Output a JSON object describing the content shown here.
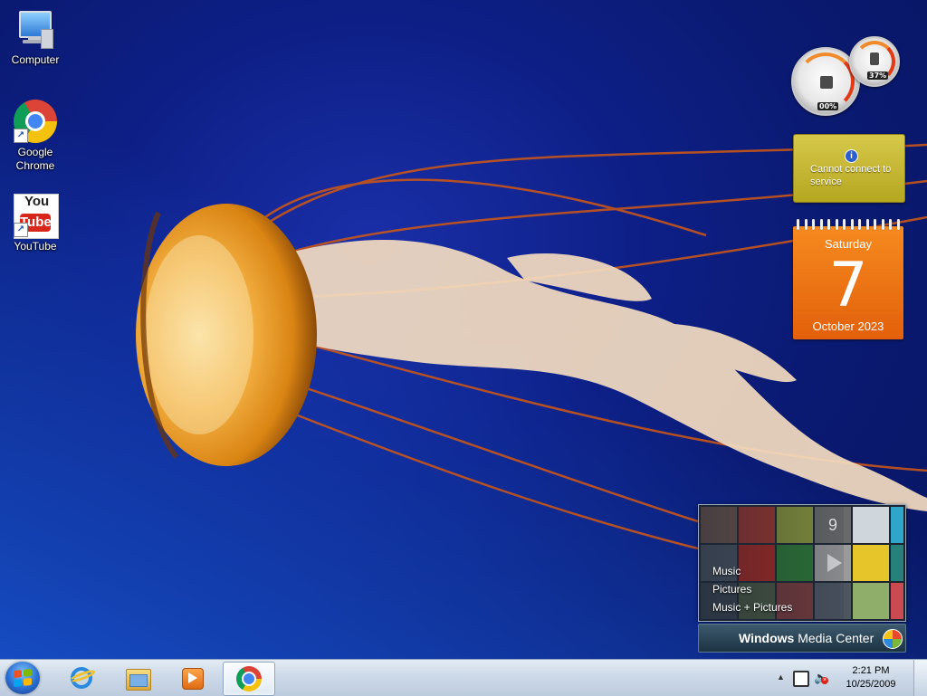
{
  "desktop": {
    "icons": [
      {
        "label": "Computer",
        "icon": "computer-icon"
      },
      {
        "label": "Google Chrome",
        "icon": "chrome-icon"
      },
      {
        "label": "YouTube",
        "icon": "youtube-icon"
      }
    ],
    "youtube_logo_text": {
      "you": "You",
      "tube": "Tube"
    }
  },
  "gadgets": {
    "cpu_meter": {
      "cpu_percent": "00%",
      "memory_percent": "37%"
    },
    "weather": {
      "message": "Cannot connect to service",
      "icon": "info-icon"
    },
    "calendar": {
      "day_of_week": "Saturday",
      "day": "7",
      "month_year": "October 2023"
    },
    "media_center": {
      "menu": [
        "Music",
        "Pictures",
        "Music + Pictures"
      ],
      "title_bold": "Windows",
      "title_rest": " Media Center",
      "tile_number": "9"
    }
  },
  "taskbar": {
    "start": "start-button",
    "items": [
      {
        "name": "internet-explorer",
        "icon": "ie-icon",
        "active": false
      },
      {
        "name": "windows-explorer",
        "icon": "folder-icon",
        "active": false
      },
      {
        "name": "media-player",
        "icon": "media-player-icon",
        "active": false
      },
      {
        "name": "google-chrome",
        "icon": "chrome-icon",
        "active": true
      }
    ],
    "tray": {
      "time": "2:21 PM",
      "date": "10/25/2009"
    }
  },
  "colors": {
    "desktop_bg": "#0d1f86",
    "calendar_orange": "#f07414",
    "weather_yellow": "#c9ba30"
  }
}
